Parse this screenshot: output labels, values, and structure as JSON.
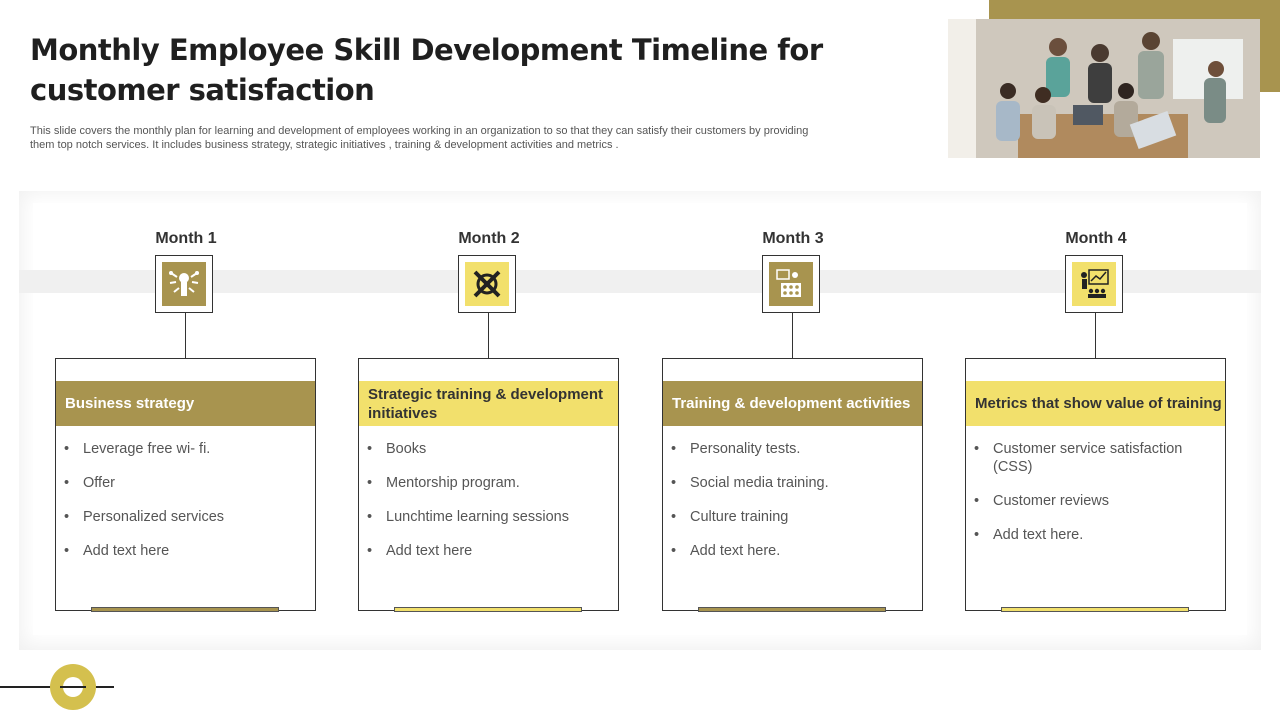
{
  "slide": {
    "title": "Monthly Employee Skill Development Timeline for customer satisfaction",
    "subtitle": "This slide covers the monthly plan for learning and development of employees working in an organization to so that they can satisfy their customers by providing them top notch services. It includes business strategy, strategic initiatives , training & development activities and metrics ."
  },
  "colors": {
    "accent_dark": "#a8944f",
    "accent_light": "#f2e06c",
    "ring": "#d4c04e"
  },
  "months": [
    {
      "label": "Month 1",
      "icon": "strategy-hand-icon",
      "heading": "Business strategy",
      "items": [
        "Leverage free wi- fi.",
        "Offer",
        "Personalized services",
        "Add text here"
      ]
    },
    {
      "label": "Month 2",
      "icon": "tools-cross-icon",
      "heading": "Strategic training & development initiatives",
      "items": [
        "Books",
        "Mentorship program.",
        "Lunchtime learning sessions",
        "Add text here"
      ]
    },
    {
      "label": "Month 3",
      "icon": "classroom-training-icon",
      "heading": "Training & development activities",
      "items": [
        "Personality tests.",
        "Social media training.",
        "Culture training",
        "Add text here."
      ]
    },
    {
      "label": "Month 4",
      "icon": "presentation-metrics-icon",
      "heading": "Metrics that show value of training",
      "items": [
        "Customer service satisfaction (CSS)",
        "Customer reviews",
        "Add text here."
      ]
    }
  ]
}
